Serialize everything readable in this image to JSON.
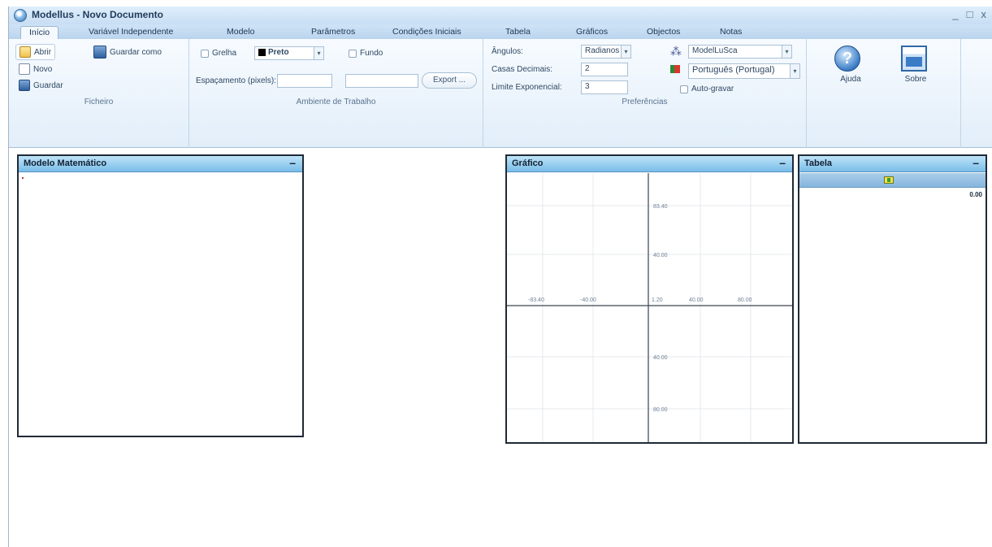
{
  "window": {
    "title": "Modellus - Novo Documento",
    "controls": [
      "_",
      "□",
      "x"
    ]
  },
  "tabs": [
    {
      "label": "Início",
      "active": true
    },
    {
      "label": "Variável Independente"
    },
    {
      "label": "Modelo"
    },
    {
      "label": "Parâmetros"
    },
    {
      "label": "Condições Iniciais"
    },
    {
      "label": "Tabela"
    },
    {
      "label": "Gráficos"
    },
    {
      "label": "Objectos"
    },
    {
      "label": "Notas"
    }
  ],
  "ribbon": {
    "ficheiro": {
      "open_label": "Abrir",
      "new_label": "Novo",
      "save_label": "Guardar",
      "saveas_label": "Guardar como",
      "group_label": "Ficheiro"
    },
    "ambiente": {
      "grid_label": "Grelha",
      "color_value": "Preto",
      "background_label": "Fundo",
      "spacing_label": "Espaçamento (pixels):",
      "spacing_value": "",
      "export_label": "Export ...",
      "group_label": "Ambiente de Trabalho"
    },
    "preferencias": {
      "angles_label": "Ângulos:",
      "angles_value": "Radianos",
      "decimals_label": "Casas Decimais:",
      "decimals_value": "2",
      "exponent_label": "Limite Exponencial:",
      "exponent_value": "3",
      "model_value": "ModelLuSca",
      "language_value": "Português (Portugal)",
      "autoupdate_label": "Auto-gravar",
      "group_label": "Preferências"
    },
    "ajuda": {
      "help_label": "Ajuda",
      "about_label": "Sobre"
    }
  },
  "panels": {
    "modelo": {
      "title": "Modelo Matemático",
      "minimize": "–"
    },
    "grafico": {
      "title": "Gráfico",
      "minimize": "–",
      "x_ticks": [
        "-83.40",
        "-40.00",
        "1.20",
        "40.00",
        "80.00"
      ],
      "y_ticks": [
        "83.40",
        "40.00",
        "40.00",
        "80.00"
      ]
    },
    "tabela": {
      "title": "Tabela",
      "minimize": "–",
      "cell_value": "0.00"
    }
  },
  "colors": {
    "panel_header": "#79bde8",
    "ribbon_bg": "#e2eef9",
    "panel_border": "#1f2a36"
  }
}
